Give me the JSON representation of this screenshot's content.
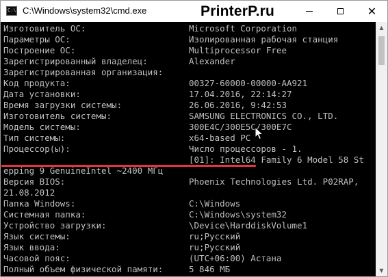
{
  "window": {
    "title": "C:\\Windows\\system32\\cmd.exe",
    "watermark": "PrinterP.ru",
    "app_icon_text": "C:\\",
    "controls": {
      "minimize": "",
      "maximize": "",
      "close": "✕"
    }
  },
  "console": {
    "lines": [
      {
        "label": "Изготовитель ОС:",
        "value": "Microsoft Corporation"
      },
      {
        "label": "Параметры ОС:",
        "value": "Изолированная рабочая станция"
      },
      {
        "label": "Построение ОС:",
        "value": "Multiprocessor Free"
      },
      {
        "label": "Зарегистрированный владелец:",
        "value": "Alexander"
      },
      {
        "label": "Зарегистрированная организация:",
        "value": ""
      },
      {
        "label": "Код продукта:",
        "value": "00327-60000-00000-AA921"
      },
      {
        "label": "Дата установки:",
        "value": "17.04.2016, 22:14:27"
      },
      {
        "label": "Время загрузки системы:",
        "value": "26.06.2016, 9:42:53"
      },
      {
        "label": "Изготовитель системы:",
        "value": "SAMSUNG ELECTRONICS CO., LTD."
      },
      {
        "label": "Модель системы:",
        "value": "300E4C/300E5C/300E7C"
      },
      {
        "label": "Тип системы:",
        "value": "x64-based PC"
      },
      {
        "label": "Процессор(ы):",
        "value": "Число процессоров - 1."
      },
      {
        "label": "",
        "value": "[01]: Intel64 Family 6 Model 58 St"
      },
      {
        "label": "epping 9 GenuineIntel ~2400 МГц",
        "value": ""
      },
      {
        "label": "Версия BIOS:",
        "value": "Phoenix Technologies Ltd. P02RAP,"
      },
      {
        "label": "21.08.2012",
        "value": ""
      },
      {
        "label": "Папка Windows:",
        "value": "C:\\Windows"
      },
      {
        "label": "Системная папка:",
        "value": "C:\\Windows\\system32"
      },
      {
        "label": "Устройство загрузки:",
        "value": "\\Device\\HarddiskVolume1"
      },
      {
        "label": "Язык системы:",
        "value": "ru;Русский"
      },
      {
        "label": "Язык ввода:",
        "value": "ru;Русский"
      },
      {
        "label": "Часовой пояс:",
        "value": "(UTC+06:00) Астана"
      },
      {
        "label": "Полный объем физической памяти:",
        "value": "5 846 МБ"
      }
    ]
  },
  "colors": {
    "console_bg": "#000000",
    "console_text": "#c0c0c0",
    "highlight_underline": "#e8323c",
    "titlebar_bg": "#ffffff"
  },
  "icons": {
    "app": "cmd-icon",
    "cursor": "mouse-pointer-icon",
    "scroll_up": "chevron-up-icon",
    "scroll_down": "chevron-down-icon"
  }
}
